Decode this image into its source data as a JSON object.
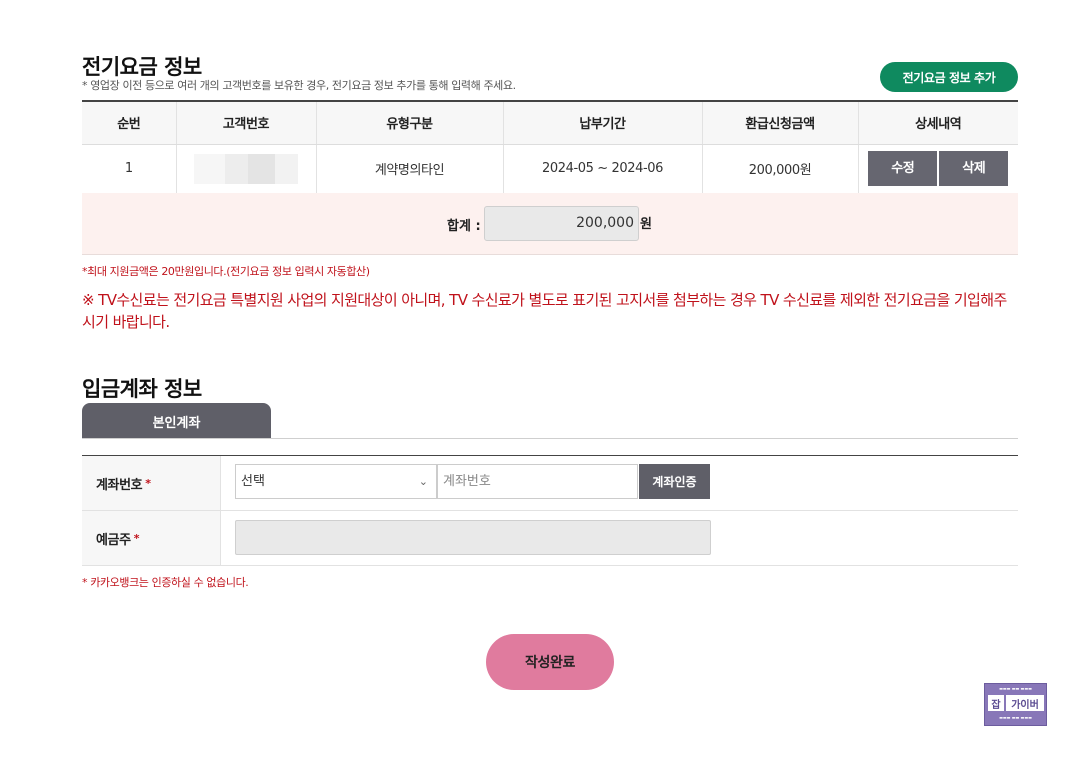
{
  "electric": {
    "title": "전기요금 정보",
    "desc": "* 영업장 이전 등으로 여러 개의 고객번호를 보유한 경우, 전기요금 정보 추가를 통해 입력해 주세요.",
    "add_button": "전기요금 정보 추가",
    "columns": [
      "순번",
      "고객번호",
      "유형구분",
      "납부기간",
      "환급신청금액",
      "상세내역"
    ],
    "rows": [
      {
        "no": "1",
        "customer_no": "",
        "type": "계약명의타인",
        "period": "2024-05 ~ 2024-06",
        "amount": "200,000원",
        "edit": "수정",
        "delete": "삭제"
      }
    ],
    "total_label": "합계 :",
    "total_value": "200,000",
    "total_unit": "원",
    "note_small": "*최대 지원금액은 20만원입니다.(전기요금 정보 입력시 자동합산)",
    "note_big": "※ TV수신료는 전기요금 특별지원 사업의 지원대상이 아니며, TV 수신료가 별도로 표기된 고지서를 첨부하는 경우 TV 수신료를 제외한 전기요금을 기입해주시기 바랍니다."
  },
  "account": {
    "title": "입금계좌 정보",
    "tab": "본인계좌",
    "account_label": "계좌번호",
    "required_mark": "*",
    "bank_select": "선택",
    "account_placeholder": "계좌번호",
    "verify_button": "계좌인증",
    "holder_label": "예금주",
    "kakao_note": "* 카카오뱅크는 인증하실 수 없습니다."
  },
  "submit_button": "작성완료",
  "badge": {
    "logo": "잡",
    "main": "가이버"
  }
}
